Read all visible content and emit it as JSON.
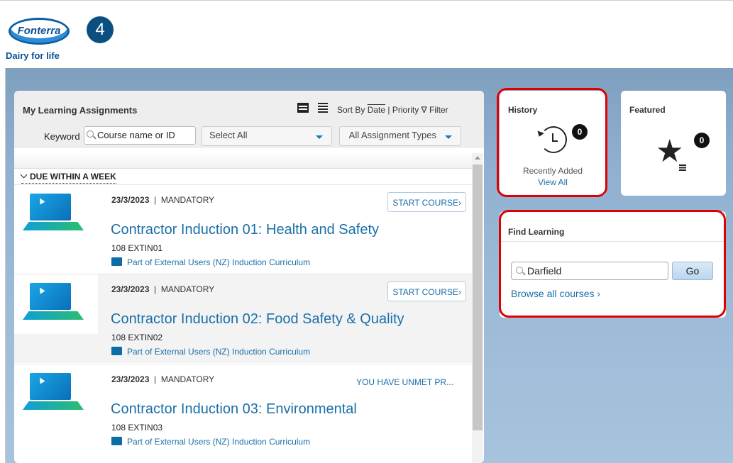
{
  "header": {
    "logo_text": "Fonterra",
    "tagline": "Dairy for life",
    "step_badge": "4"
  },
  "assignments": {
    "title": "My Learning Assignments",
    "sort_prefix": "Sort By",
    "sort_date": "Date",
    "sort_separator": "|",
    "sort_priority": "Priority",
    "filter_label": "Filter",
    "keyword_label": "Keyword",
    "search_placeholder": "Course name or ID",
    "select_all": "Select All",
    "assignment_types": "All Assignment Types",
    "group_header": "DUE WITHIN A WEEK",
    "courses": [
      {
        "date": "23/3/2023",
        "type": "MANDATORY",
        "action": "START COURSE",
        "title": "Contractor Induction 01: Health and Safety",
        "code": "108 EXTIN01",
        "part_of": "Part of External Users (NZ) Induction Curriculum"
      },
      {
        "date": "23/3/2023",
        "type": "MANDATORY",
        "action": "START COURSE",
        "title": "Contractor Induction 02: Food Safety & Quality",
        "code": "108 EXTIN02",
        "part_of": "Part of External Users (NZ) Induction Curriculum"
      },
      {
        "date": "23/3/2023",
        "type": "MANDATORY",
        "action": "YOU HAVE UNMET PR...",
        "title": "Contractor Induction 03: Environmental",
        "code": "108 EXTIN03",
        "part_of": "Part of External Users (NZ) Induction Curriculum"
      }
    ]
  },
  "history": {
    "title": "History",
    "count": "0",
    "recent_label": "Recently Added",
    "view_all": "View All"
  },
  "featured": {
    "title": "Featured",
    "count": "0"
  },
  "find_learning": {
    "title": "Find Learning",
    "search_value": "Darfield",
    "go_label": "Go",
    "browse_label": "Browse all courses"
  },
  "colors": {
    "link_blue": "#1a6fa8",
    "highlight_red": "#e00000",
    "badge_navy": "#0b4f80"
  }
}
